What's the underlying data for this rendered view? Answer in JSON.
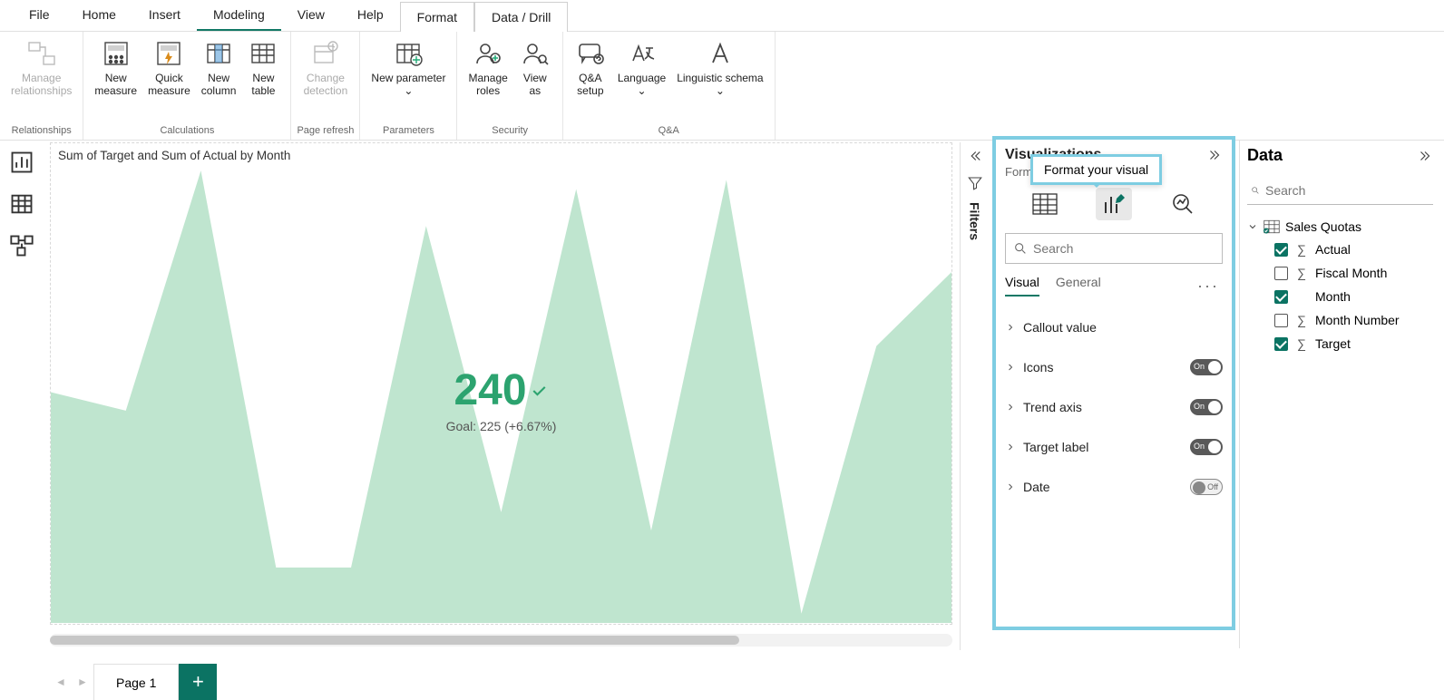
{
  "menu": [
    "File",
    "Home",
    "Insert",
    "Modeling",
    "View",
    "Help",
    "Format",
    "Data / Drill"
  ],
  "menu_active_under": "Modeling",
  "menu_boxed": [
    "Format",
    "Data / Drill"
  ],
  "ribbon": {
    "groups": [
      {
        "label": "Relationships",
        "items": [
          {
            "label": "Manage relationships",
            "disabled": true,
            "icon": "relationships"
          }
        ]
      },
      {
        "label": "Calculations",
        "items": [
          {
            "label": "New measure",
            "icon": "measure"
          },
          {
            "label": "Quick measure",
            "icon": "quickmeasure"
          },
          {
            "label": "New column",
            "icon": "column"
          },
          {
            "label": "New table",
            "icon": "table"
          }
        ]
      },
      {
        "label": "Page refresh",
        "items": [
          {
            "label": "Change detection",
            "disabled": true,
            "icon": "detect"
          }
        ]
      },
      {
        "label": "Parameters",
        "items": [
          {
            "label": "New parameter ⌄",
            "icon": "param"
          }
        ]
      },
      {
        "label": "Security",
        "items": [
          {
            "label": "Manage roles",
            "icon": "roles"
          },
          {
            "label": "View as",
            "icon": "viewas"
          }
        ]
      },
      {
        "label": "Q&A",
        "items": [
          {
            "label": "Q&A setup",
            "icon": "qna"
          },
          {
            "label": "Language ⌄",
            "icon": "lang"
          },
          {
            "label": "Linguistic schema ⌄",
            "icon": "ling"
          }
        ]
      }
    ]
  },
  "visual": {
    "title": "Sum of Target and Sum of Actual by Month",
    "callout_value": "240",
    "callout_goal": "Goal: 225 (+6.67%)"
  },
  "chart_data": {
    "type": "area",
    "title": "Sum of Target and Sum of Actual by Month",
    "x": [
      0,
      1,
      2,
      3,
      4,
      5,
      6,
      7,
      8,
      9,
      10,
      11,
      12
    ],
    "values": [
      250,
      230,
      490,
      60,
      60,
      430,
      120,
      470,
      100,
      480,
      10,
      300,
      380
    ],
    "ylim": [
      0,
      500
    ],
    "callout": 240,
    "goal": 225,
    "delta_pct": 6.67
  },
  "pagetabs": {
    "current": "Page 1"
  },
  "filters_label": "Filters",
  "vispane": {
    "title": "Visualizations",
    "sub": "Format visual",
    "tooltip": "Format your visual",
    "search_placeholder": "Search",
    "subtabs": [
      "Visual",
      "General"
    ],
    "subtab_active": "Visual",
    "options": [
      {
        "label": "Callout value",
        "toggle": null
      },
      {
        "label": "Icons",
        "toggle": "On"
      },
      {
        "label": "Trend axis",
        "toggle": "On"
      },
      {
        "label": "Target label",
        "toggle": "On"
      },
      {
        "label": "Date",
        "toggle": "Off"
      }
    ]
  },
  "datapane": {
    "title": "Data",
    "search_placeholder": "Search",
    "table": "Sales Quotas",
    "fields": [
      {
        "name": "Actual",
        "checked": true,
        "sigma": true
      },
      {
        "name": "Fiscal Month",
        "checked": false,
        "sigma": true
      },
      {
        "name": "Month",
        "checked": true,
        "sigma": false
      },
      {
        "name": "Month Number",
        "checked": false,
        "sigma": true
      },
      {
        "name": "Target",
        "checked": true,
        "sigma": true
      }
    ]
  }
}
